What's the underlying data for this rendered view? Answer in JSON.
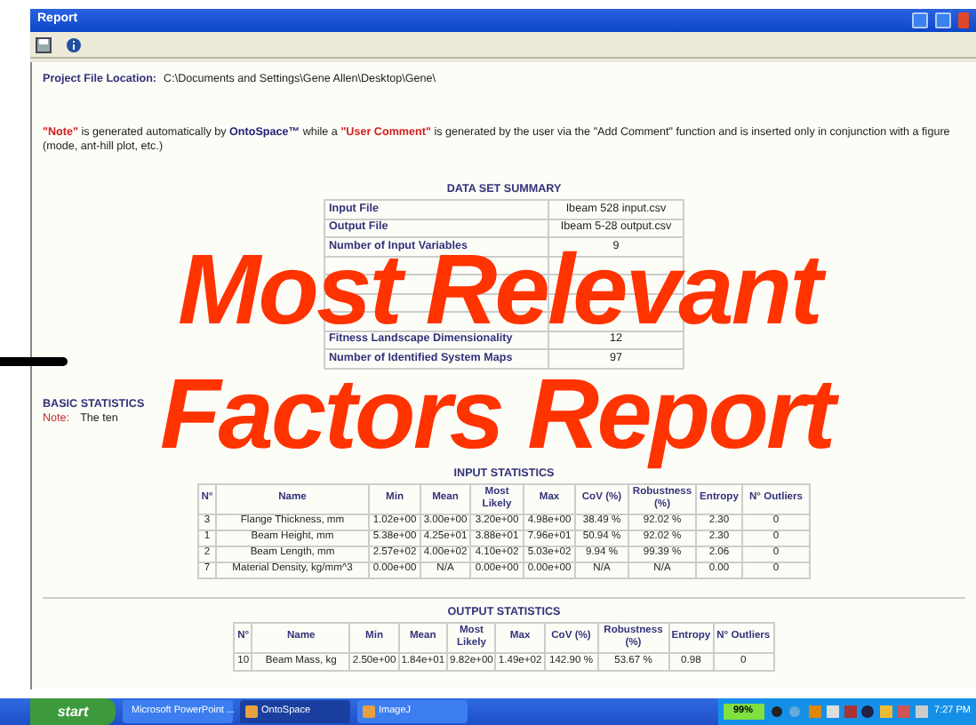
{
  "window": {
    "title": "Report"
  },
  "project_file": {
    "label": "Project File Location:",
    "value": "C:\\Documents and Settings\\Gene Allen\\Desktop\\Gene\\"
  },
  "note_text": "**\"Note\"** is generated automatically by **OntoSpace™** while a **\"User Comment\"** is generated by the user via the \"Add Comment\" function and is inserted only in conjunction with a figure (mode, ant-hill plot, etc.)",
  "data_set_summary": {
    "title": "DATA SET SUMMARY",
    "rows": [
      {
        "label": "Input File",
        "value": "Ibeam 528 input.csv"
      },
      {
        "label": "Output File",
        "value": "Ibeam 5-28 output.csv"
      },
      {
        "label": "Number of Input Variables",
        "value": "9"
      },
      {},
      {},
      {},
      {},
      {
        "label": "Fitness Landscape Dimensionality",
        "value": "12"
      },
      {
        "label": "Number of Identified System Maps",
        "value": "97"
      }
    ]
  },
  "basic_statistics": {
    "title": "BASIC STATISTICS",
    "note_label": "Note:",
    "note_text": "The ten"
  },
  "input_statistics": {
    "title": "INPUT STATISTICS",
    "columns": [
      "N°",
      "Name",
      "Min",
      "Mean",
      "Most Likely",
      "Max",
      "CoV (%)",
      "Robustness (%)",
      "Entropy",
      "N° Outliers"
    ],
    "rows": [
      [
        "3",
        "Flange Thickness, mm",
        "1.02e+00",
        "3.00e+00",
        "3.20e+00",
        "4.98e+00",
        "38.49 %",
        "92.02 %",
        "2.30",
        "0"
      ],
      [
        "1",
        "Beam Height, mm",
        "5.38e+00",
        "4.25e+01",
        "3.88e+01",
        "7.96e+01",
        "50.94 %",
        "92.02 %",
        "2.30",
        "0"
      ],
      [
        "2",
        "Beam Length, mm",
        "2.57e+02",
        "4.00e+02",
        "4.10e+02",
        "5.03e+02",
        "9.94 %",
        "99.39 %",
        "2.06",
        "0"
      ],
      [
        "7",
        "Material Density, kg/mm^3",
        "0.00e+00",
        "N/A",
        "0.00e+00",
        "0.00e+00",
        "N/A",
        "N/A",
        "0.00",
        "0"
      ]
    ]
  },
  "output_statistics": {
    "title": "OUTPUT STATISTICS",
    "columns": [
      "N°",
      "Name",
      "Min",
      "Mean",
      "Most Likely",
      "Max",
      "CoV (%)",
      "Robustness (%)",
      "Entropy",
      "N° Outliers"
    ],
    "rows": [
      [
        "10",
        "Beam Mass, kg",
        "2.50e+00",
        "1.84e+01",
        "9.82e+00",
        "1.49e+02",
        "142.90 %",
        "53.67 %",
        "0.98",
        "0"
      ]
    ]
  },
  "overlay_title": [
    "Most Relevant",
    "Factors Report"
  ],
  "taskbar": {
    "start": "start",
    "tasks": [
      {
        "label": "Microsoft PowerPoint ...",
        "selected": false
      },
      {
        "label": "OntoSpace",
        "selected": true
      },
      {
        "label": "ImageJ",
        "selected": false
      }
    ],
    "battery": "99%",
    "time": "7:27 PM"
  }
}
